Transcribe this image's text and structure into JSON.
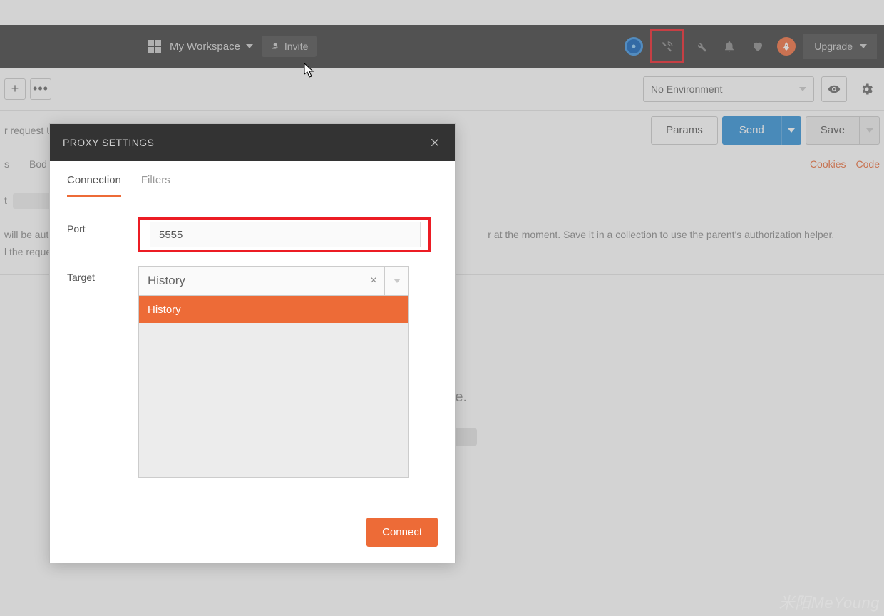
{
  "header": {
    "workspace_label": "My Workspace",
    "invite_label": "Invite",
    "upgrade_label": "Upgrade"
  },
  "row2": {
    "plus": "+",
    "dots": "•••",
    "env_label": "No Environment"
  },
  "row3": {
    "url_placeholder": "r request U",
    "params_label": "Params",
    "send_label": "Send",
    "save_label": "Save"
  },
  "row4": {
    "tab_s": "s",
    "tab_body": "Bod",
    "cookies_label": "Cookies",
    "code_label": "Code"
  },
  "body_section": {
    "line1_left": "t",
    "line2_left": " will be aut",
    "line2_right": "r at the moment. Save it in a collection to use the parent's authorization helper.",
    "line3_left": "l the reque"
  },
  "response": {
    "text_fragment": "sponse."
  },
  "modal": {
    "title": "PROXY SETTINGS",
    "tabs": {
      "connection": "Connection",
      "filters": "Filters"
    },
    "port_label": "Port",
    "port_value": "5555",
    "target_label": "Target",
    "target_selected": "History",
    "target_clear": "×",
    "target_options": [
      "History"
    ],
    "connect_label": "Connect"
  },
  "watermark": "米阳MeYoung"
}
